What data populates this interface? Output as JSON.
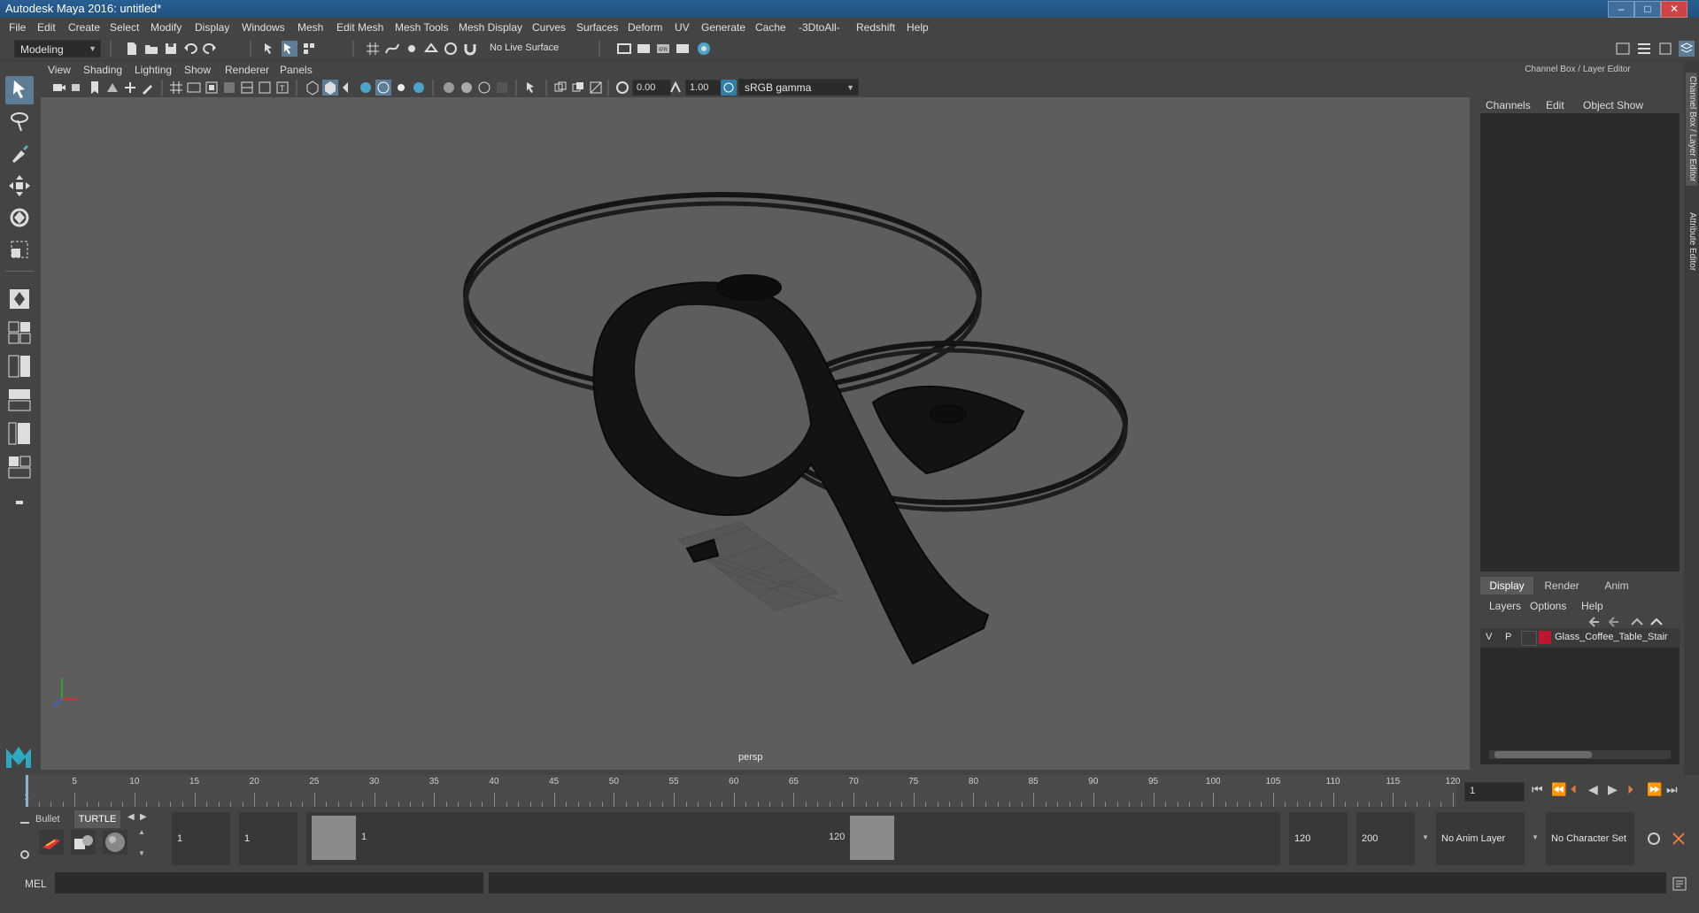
{
  "window": {
    "title": "Autodesk Maya 2016: untitled*",
    "controls": [
      "–",
      "□",
      "✕"
    ]
  },
  "menubar": {
    "items": [
      "File",
      "Edit",
      "Create",
      "Select",
      "Modify",
      "Display",
      "Windows",
      "Mesh",
      "Edit Mesh",
      "Mesh Tools",
      "Mesh Display",
      "Curves",
      "Surfaces",
      "Deform",
      "UV",
      "Generate",
      "Cache",
      "-3DtoAll-",
      "Redshift",
      "Help"
    ]
  },
  "toolbar": {
    "mode": "Modeling",
    "live_surface": "No Live Surface"
  },
  "viewport": {
    "menu": [
      "View",
      "Shading",
      "Lighting",
      "Show",
      "Renderer",
      "Panels"
    ],
    "exposure": "0.00",
    "gamma": "1.00",
    "color_space": "sRGB gamma",
    "camera_label": "persp",
    "background_color": "#5d5d5d"
  },
  "channel_box": {
    "header": "Channel Box / Layer Editor",
    "menu": [
      "Channels",
      "Edit",
      "Object",
      "Show"
    ]
  },
  "layer_editor": {
    "tabs": [
      "Display",
      "Render",
      "Anim"
    ],
    "active_tab": "Display",
    "menu": [
      "Layers",
      "Options",
      "Help"
    ],
    "layers": [
      {
        "visible": "V",
        "playback": "P",
        "color": "#c0152e",
        "name": "Glass_Coffee_Table_Stair"
      }
    ]
  },
  "side_tabs": [
    "Channel Box / Layer Editor",
    "Attribute Editor"
  ],
  "timeline": {
    "ticks": [
      1,
      5,
      10,
      15,
      20,
      25,
      30,
      35,
      40,
      45,
      50,
      55,
      60,
      65,
      70,
      75,
      80,
      85,
      90,
      95,
      100,
      105,
      110,
      115,
      120
    ],
    "current_frame": "1"
  },
  "range": {
    "shelf_tabs": [
      "Bullet",
      "TURTLE"
    ],
    "start_frame": "1",
    "playback_start": "1",
    "range_start_label": "1",
    "range_end_label": "120",
    "playback_end": "120",
    "end_frame": "200",
    "anim_layer": "No Anim Layer",
    "character_set": "No Character Set"
  },
  "command_line": {
    "label": "MEL"
  }
}
